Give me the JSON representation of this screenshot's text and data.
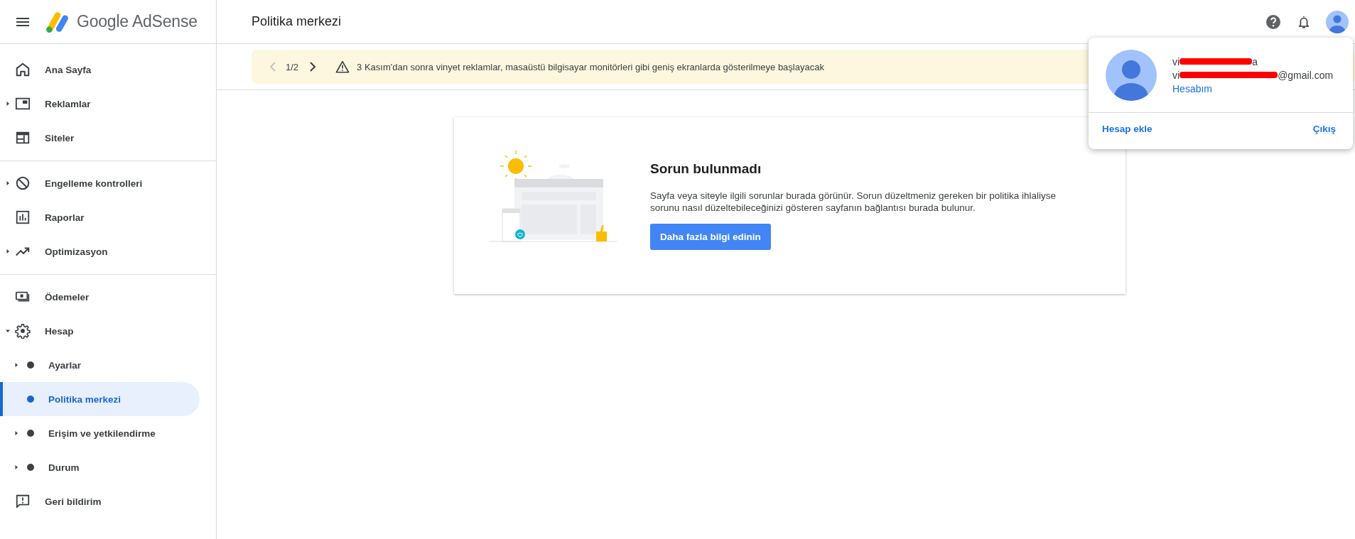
{
  "header": {
    "product": "Google AdSense",
    "page_title": "Politika merkezi"
  },
  "sidebar": {
    "groups": [
      [
        {
          "label": "Ana Sayfa",
          "selected": false
        },
        {
          "label": "Reklamlar",
          "selected": false,
          "expanded": false
        },
        {
          "label": "Siteler",
          "selected": false
        }
      ],
      [
        {
          "label": "Engelleme kontrolleri",
          "selected": false,
          "expanded": false
        },
        {
          "label": "Raporlar",
          "selected": false
        },
        {
          "label": "Optimizasyon",
          "selected": false,
          "expanded": false
        }
      ],
      [
        {
          "label": "Ödemeler",
          "selected": false
        },
        {
          "label": "Hesap",
          "selected": false,
          "expanded": true,
          "children": [
            {
              "label": "Ayarlar",
              "selected": false,
              "expanded": false
            },
            {
              "label": "Politika merkezi",
              "selected": true
            },
            {
              "label": "Erişim ve yetkilendirme",
              "selected": false,
              "expanded": false
            },
            {
              "label": "Durum",
              "selected": false,
              "expanded": false
            }
          ]
        },
        {
          "label": "Geri bildirim",
          "selected": false
        }
      ]
    ]
  },
  "banner": {
    "pager": "1/2",
    "message": "3 Kasım'dan sonra vinyet reklamlar, masaüstü bilgisayar monitörleri gibi geniş ekranlarda gösterilmeye başlayacak"
  },
  "card": {
    "title": "Sorun bulunmadı",
    "body": "Sayfa veya siteyle ilgili sorunlar burada görünür. Sorun düzeltmeniz gereken bir politika ihlaliyse sorunu nasıl düzeltebileceğinizi gösteren sayfanın bağlantısı burada bulunur.",
    "button": "Daha fazla bilgi edinin"
  },
  "account_popup": {
    "name_start": "vi",
    "name_end": "a",
    "email_start": "vi",
    "email_end": "@gmail.com",
    "my_account": "Hesabım",
    "add_account": "Hesap ekle",
    "sign_out": "Çıkış"
  }
}
